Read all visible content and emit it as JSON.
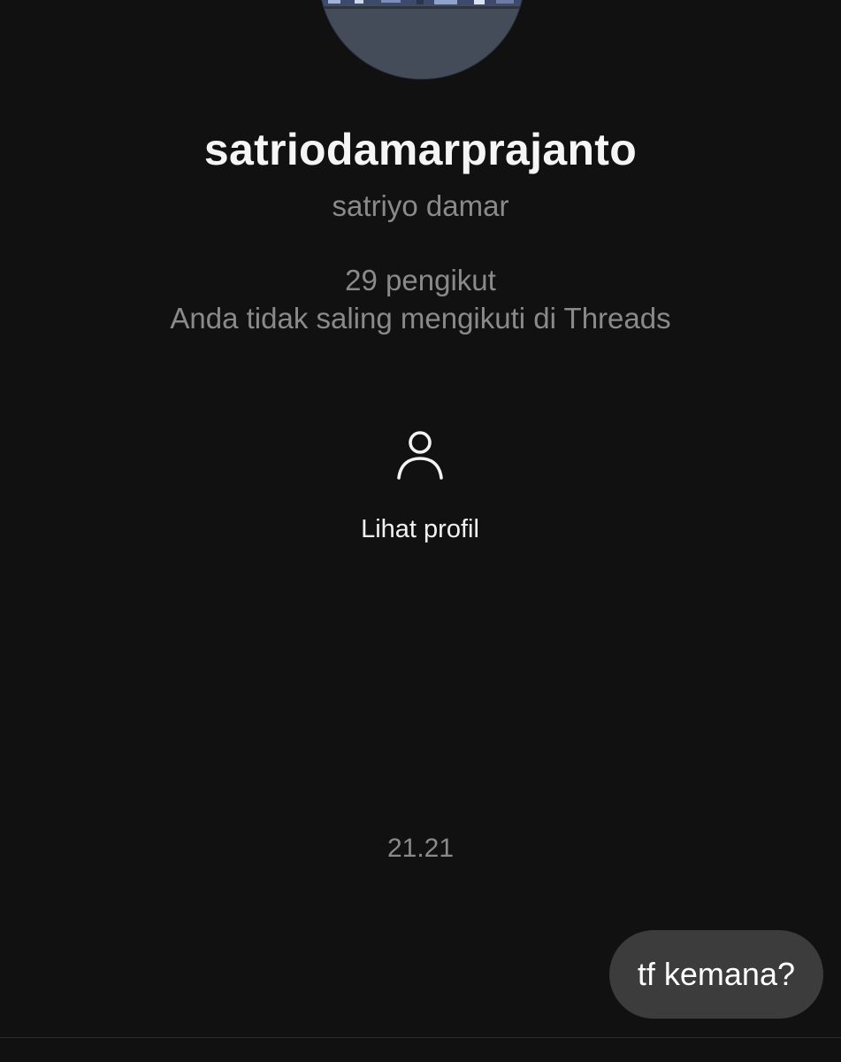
{
  "profile": {
    "username": "satriodamarprajanto",
    "full_name": "satriyo damar",
    "followers_text": "29 pengikut",
    "mutual_text": "Anda tidak saling mengikuti di Threads",
    "avatar_icon": "profile-photo"
  },
  "actions": {
    "view_profile_label": "Lihat profil",
    "view_profile_icon": "person-icon"
  },
  "conversation": {
    "timestamp": "21.21",
    "messages": [
      {
        "sender": "me",
        "text": "tf kemana?"
      }
    ]
  },
  "colors": {
    "background": "#111111",
    "secondary_text": "#8a8a8a",
    "bubble": "#3c3c3c"
  }
}
